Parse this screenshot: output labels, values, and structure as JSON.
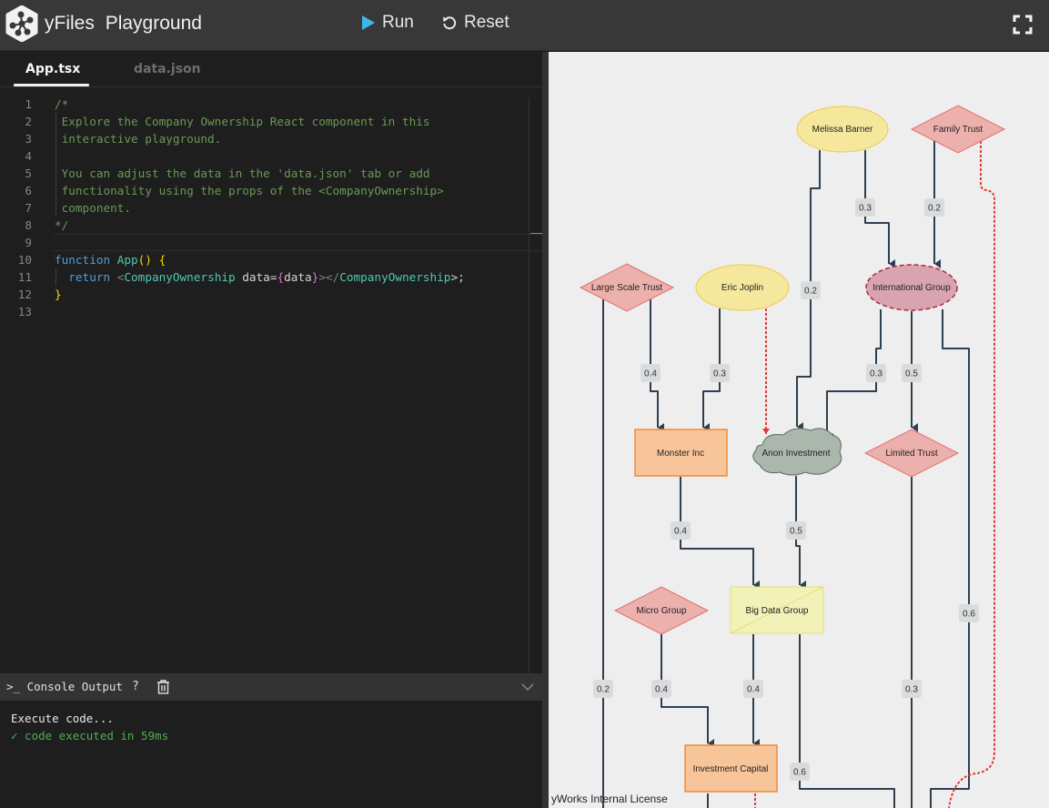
{
  "header": {
    "brand_name": "yFiles",
    "brand_product": "Playground",
    "run_label": "Run",
    "reset_label": "Reset",
    "accent_color": "#3fb7e6"
  },
  "editor": {
    "tabs": [
      {
        "label": "App.tsx",
        "active": true
      },
      {
        "label": "data.json",
        "active": false
      }
    ],
    "lines": [
      {
        "n": "1"
      },
      {
        "n": "2"
      },
      {
        "n": "3"
      },
      {
        "n": "4"
      },
      {
        "n": "5"
      },
      {
        "n": "6"
      },
      {
        "n": "7"
      },
      {
        "n": "8"
      },
      {
        "n": "9"
      },
      {
        "n": "10"
      },
      {
        "n": "11"
      },
      {
        "n": "12"
      },
      {
        "n": "13"
      }
    ],
    "code": {
      "l1": "/*",
      "l2": " Explore the Company Ownership React component in this",
      "l3": " interactive playground.",
      "l4": "",
      "l5": " You can adjust the data in the 'data.json' tab or add",
      "l6": " functionality using the props of the <CompanyOwnership>",
      "l7": " component.",
      "l8": "*/",
      "l10_kw": "function",
      "l10_fn": "App",
      "l10_paren": "()",
      "l10_brace": "{",
      "l11_kw": "return",
      "l11_lt": "<",
      "l11_tag": "CompanyOwnership",
      "l11_attr": " data=",
      "l11_ob": "{",
      "l11_val": "data",
      "l11_cb": "}",
      "l11_close": "></",
      "l11_tag2": "CompanyOwnership",
      "l11_end": ">;",
      "l12": "}"
    }
  },
  "console": {
    "title": ">_ Console Output",
    "help": "?",
    "output": [
      "Execute code...",
      "✓ code executed in 59ms"
    ]
  },
  "graph": {
    "license": "yWorks Internal License",
    "colors": {
      "person_fill": "#f5e79c",
      "person_stroke": "#e9cc4c",
      "trust_fill": "#ecb0ad",
      "trust_stroke": "#e07070",
      "corp_fill": "#f8c59a",
      "corp_stroke": "#f08a3c",
      "group_fill": "#d9a3b0",
      "group_stroke": "#a8294f",
      "cloud_fill": "#abb7ad",
      "cloud_stroke": "#5a6a5e",
      "bigdata_fill": "#f2f2b8",
      "bigdata_stroke": "#e0e07a",
      "edge": "#2e3f4f",
      "dashed_edge": "#e53935",
      "label_bg": "#d9dbdd"
    },
    "nodes": [
      {
        "id": "melissa",
        "label": "Melissa Barner",
        "type": "person"
      },
      {
        "id": "family",
        "label": "Family Trust",
        "type": "trust"
      },
      {
        "id": "largescale",
        "label": "Large Scale Trust",
        "type": "trust"
      },
      {
        "id": "eric",
        "label": "Eric Joplin",
        "type": "person"
      },
      {
        "id": "intl",
        "label": "International Group",
        "type": "group"
      },
      {
        "id": "monster",
        "label": "Monster Inc",
        "type": "corp"
      },
      {
        "id": "anon",
        "label": "Anon Investment",
        "type": "cloud"
      },
      {
        "id": "limited",
        "label": "Limited Trust",
        "type": "trust"
      },
      {
        "id": "micro",
        "label": "Micro Group",
        "type": "trust"
      },
      {
        "id": "bigdata",
        "label": "Big Data Group",
        "type": "bigdata"
      },
      {
        "id": "invcap",
        "label": "Investment Capital",
        "type": "corp"
      }
    ],
    "edge_labels": [
      {
        "id": "e1",
        "value": "0.3"
      },
      {
        "id": "e2",
        "value": "0.2"
      },
      {
        "id": "e3",
        "value": "0.2"
      },
      {
        "id": "e4",
        "value": "0.4"
      },
      {
        "id": "e5",
        "value": "0.3"
      },
      {
        "id": "e6",
        "value": "0.3"
      },
      {
        "id": "e7",
        "value": "0.5"
      },
      {
        "id": "e8",
        "value": "0.4"
      },
      {
        "id": "e9",
        "value": "0.5"
      },
      {
        "id": "e10",
        "value": "0.6"
      },
      {
        "id": "e11",
        "value": "0.2"
      },
      {
        "id": "e12",
        "value": "0.4"
      },
      {
        "id": "e13",
        "value": "0.4"
      },
      {
        "id": "e14",
        "value": "0.3"
      },
      {
        "id": "e15",
        "value": "0.6"
      }
    ]
  }
}
